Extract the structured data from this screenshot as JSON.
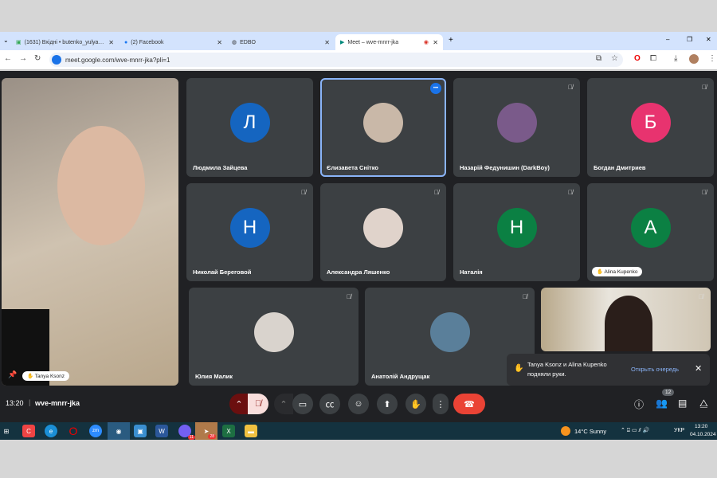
{
  "browser": {
    "tabs": [
      {
        "label": "(1631) Вхідні • butenko_yulya…",
        "icon": "gmail-icon"
      },
      {
        "label": "(2) Facebook",
        "icon": "facebook-icon"
      },
      {
        "label": "EDBO",
        "icon": "globe-icon"
      },
      {
        "label": "Meet – wve-mnrr-jka",
        "icon": "meet-icon",
        "active": true
      }
    ],
    "url": "meet.google.com/wve-mnrr-jka?pli=1"
  },
  "self": {
    "name": "Tanya Ksonz"
  },
  "tiles": [
    {
      "name": "Людмила Зайцева",
      "initial": "Л",
      "color": "#1565c0",
      "muted": false
    },
    {
      "name": "Єлизавета Снітко",
      "photo": "#c9b8a8",
      "muted": false,
      "active": true
    },
    {
      "name": "Назарій Федунишин (DarkBoy)",
      "photo": "#7a5a8a",
      "muted": true
    },
    {
      "name": "Богдан Дмитриев",
      "initial": "Б",
      "color": "#e8336f",
      "muted": true
    },
    {
      "name": "Николай Береговой",
      "initial": "Н",
      "color": "#1565c0",
      "muted": true
    },
    {
      "name": "Александра Ляшенко",
      "photo": "#e0d3cb",
      "muted": true
    },
    {
      "name": "Наталія",
      "initial": "Н",
      "color": "#0b8043",
      "muted": true
    },
    {
      "name": "Alina Kupenko",
      "initial": "A",
      "color": "#0b8043",
      "muted": true,
      "hand": true
    },
    {
      "name": "Юлия Малик",
      "photo": "#d9d3cd",
      "muted": true
    },
    {
      "name": "Анатолій Андрущак",
      "photo": "#5a7f9a",
      "muted": true
    },
    {
      "name": "",
      "video": true,
      "muted": true
    }
  ],
  "toast": {
    "text1": "Tanya Ksonz и Alina Kupenko",
    "text2": "подняли руки.",
    "action": "Открыть очередь"
  },
  "bottom": {
    "time": "13:20",
    "code": "wve-mnrr-jka",
    "participants": "12"
  },
  "taskbar": {
    "weather": "14°C  Sunny",
    "lang": "УКР",
    "time": "13:20",
    "date": "04.10.2024",
    "viber_badge": "11",
    "telegram_badge": "28"
  }
}
